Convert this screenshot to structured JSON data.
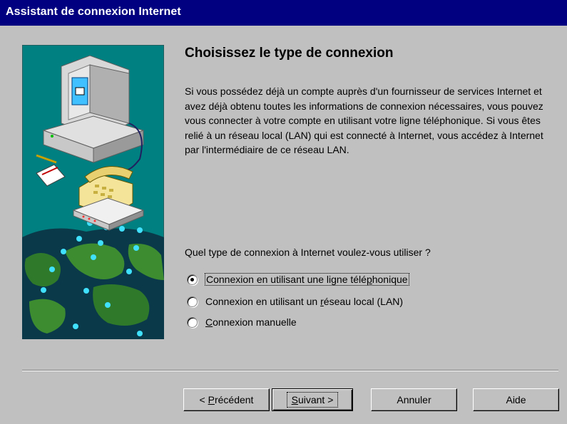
{
  "window": {
    "title": "Assistant de connexion Internet"
  },
  "page": {
    "heading": "Choisissez le type de connexion",
    "description": "Si vous possédez déjà un compte auprès d'un fournisseur de services Internet et avez déjà obtenu toutes les informations de connexion nécessaires, vous pouvez vous connecter à votre compte en utilisant votre ligne téléphonique. Si vous êtes relié à un réseau local (LAN) qui est connecté à Internet, vous accédez à Internet par l'intermédiaire de ce réseau LAN.",
    "question": "Quel type de connexion à Internet voulez-vous utiliser ?"
  },
  "options": [
    {
      "pre": "Connexion en utilisant une ligne télé",
      "key": "p",
      "post": "honique",
      "selected": true
    },
    {
      "pre": "Connexion en utilisant un ",
      "key": "r",
      "post": "éseau local (LAN)",
      "selected": false
    },
    {
      "pre": "",
      "key": "C",
      "post": "onnexion manuelle",
      "selected": false
    }
  ],
  "buttons": {
    "back": {
      "pre": "< ",
      "key": "P",
      "post": "récédent"
    },
    "next": {
      "pre": "",
      "key": "S",
      "post": "uivant >"
    },
    "cancel": "Annuler",
    "help": "Aide"
  },
  "colors": {
    "titlebar": "#000080",
    "face": "#c0c0c0",
    "illustration_bg": "#008080"
  },
  "icons": {
    "illustration": "computer-phone-internet-illustration"
  }
}
